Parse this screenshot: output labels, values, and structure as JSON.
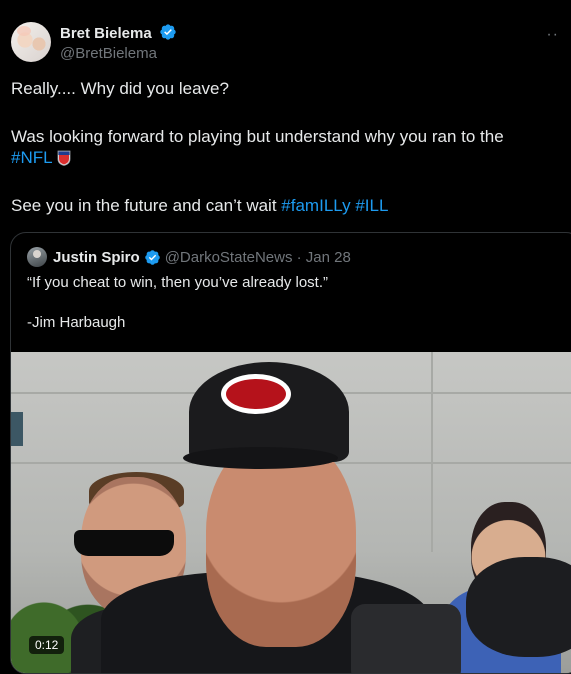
{
  "author": {
    "display_name": "Bret Bielema",
    "handle": "@BretBielema",
    "avatar_icon": "avatar",
    "verified_icon": "verified-badge-icon"
  },
  "more_label": "··",
  "tweet": {
    "line1": "Really.... Why did you leave?",
    "line2_text": "Was looking forward to playing but understand why you ran to the",
    "line2_tag": "#NFL",
    "line3_text": "See you in the future and can’t wait ",
    "line3_tag1": "#famILLy",
    "line3_tag2": "#ILL"
  },
  "quote": {
    "display_name": "Justin Spiro",
    "handle_date": "@DarkoStateNews · Jan 28",
    "line1": "“If you cheat to win, then you’ve already lost.”",
    "line2": "-Jim Harbaugh",
    "video_time": "0:12"
  },
  "colors": {
    "background": "#000000",
    "text": "#e7e9ea",
    "secondary": "#71767b",
    "accent": "#1d9bf0"
  }
}
